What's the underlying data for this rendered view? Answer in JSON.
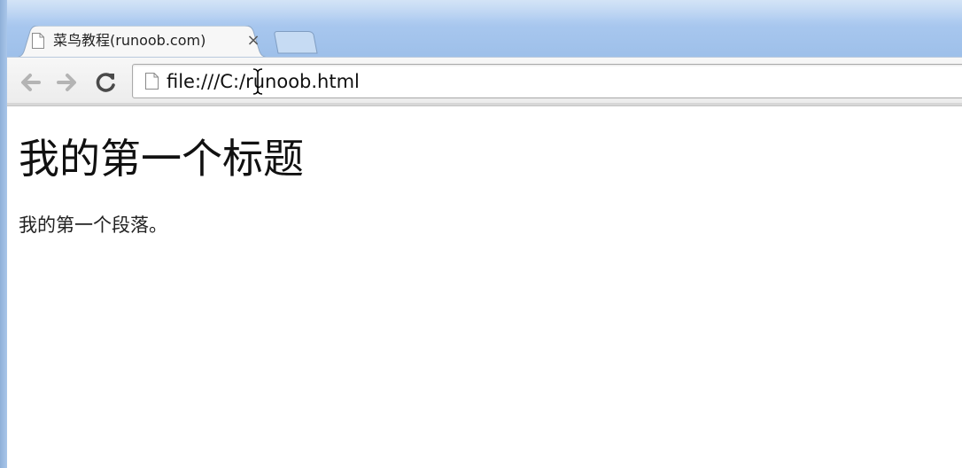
{
  "browser": {
    "tab": {
      "title": "菜鸟教程(runoob.com)",
      "close_label": "×",
      "favicon": "page-icon"
    },
    "new_tab": {
      "icon": "new-tab-icon"
    },
    "toolbar": {
      "back_icon": "back-arrow-icon",
      "forward_icon": "forward-arrow-icon",
      "reload_icon": "reload-icon",
      "address": "file:///C:/runoob.html",
      "address_icon": "page-icon",
      "cursor": "text-cursor-icon"
    }
  },
  "page": {
    "heading": "我的第一个标题",
    "paragraph": "我的第一个段落。"
  },
  "colors": {
    "frame": "#a9c8ef",
    "toolbar": "#f2f2f2",
    "text": "#111111"
  }
}
